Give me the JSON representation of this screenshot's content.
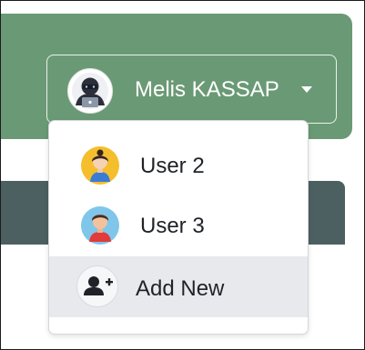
{
  "user_menu": {
    "current_user": "Melis KASSAP",
    "current_user_avatar_icon": "hacker-avatar-icon",
    "caret_icon": "caret-down-icon"
  },
  "dropdown": {
    "items": [
      {
        "label": "User 2",
        "icon": "female-user-avatar-icon"
      },
      {
        "label": "User 3",
        "icon": "male-user-avatar-icon"
      }
    ],
    "add_new": {
      "label": "Add New",
      "icon": "add-user-icon"
    }
  },
  "colors": {
    "navbar": "#6a9a75",
    "dark_bar": "#4d6061",
    "hover_item": "#e7e9ec",
    "text": "#1f2328"
  }
}
